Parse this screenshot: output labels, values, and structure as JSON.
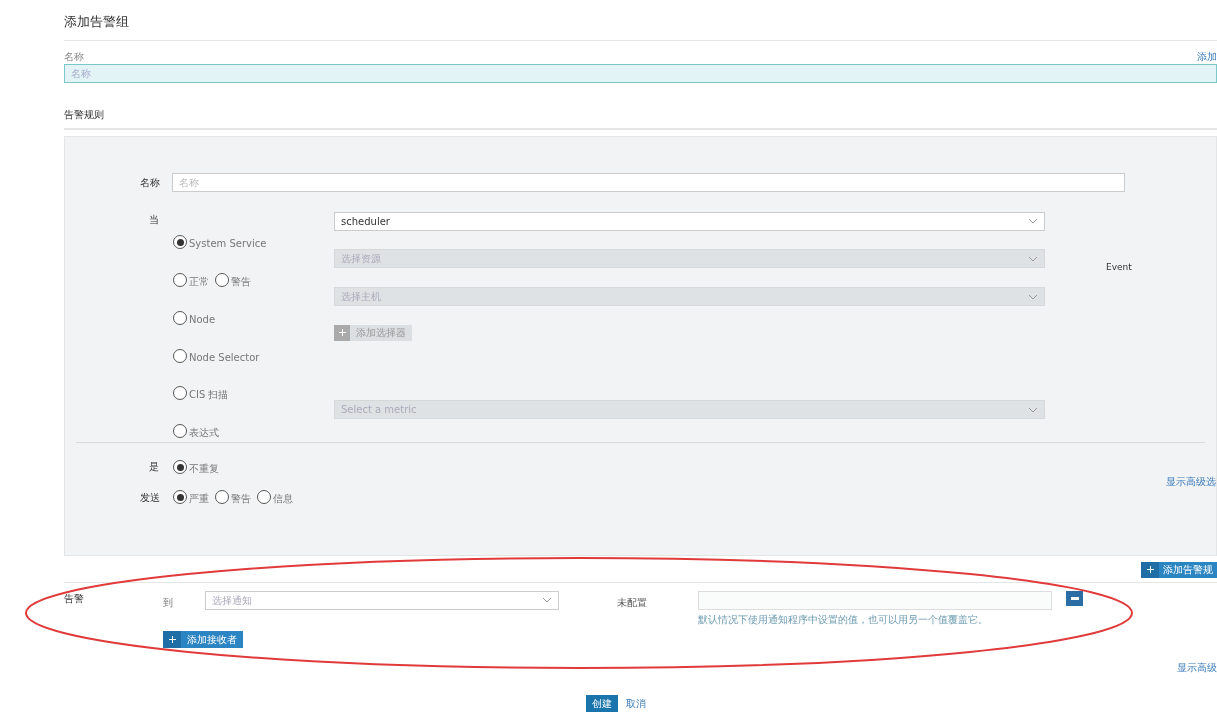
{
  "title": "添加告警组",
  "group_name": {
    "label": "名称",
    "placeholder": "名称",
    "side_link": "添加"
  },
  "rules_heading": "告警规则",
  "rule": {
    "name_label": "名称",
    "name_placeholder": "名称",
    "when_label": "当",
    "sources": [
      {
        "options": [
          {
            "label": "System Service",
            "selected": true
          }
        ],
        "select": {
          "value": "scheduler",
          "disabled": false
        }
      },
      {
        "options": [
          {
            "label": "正常",
            "selected": false
          },
          {
            "label": "警告",
            "selected": false
          }
        ],
        "select": {
          "placeholder": "选择资源",
          "disabled": true
        }
      },
      {
        "options": [
          {
            "label": "Node",
            "selected": false
          }
        ],
        "select": {
          "placeholder": "选择主机",
          "disabled": true
        }
      },
      {
        "options": [
          {
            "label": "Node Selector",
            "selected": false
          }
        ],
        "button": {
          "label": "添加选择器",
          "disabled": true
        }
      },
      {
        "options": [
          {
            "label": "CIS 扫描",
            "selected": false
          }
        ]
      },
      {
        "options": [
          {
            "label": "表达式",
            "selected": false
          }
        ],
        "select": {
          "placeholder": "Select a metric",
          "disabled": true
        }
      }
    ],
    "event_label": "Event",
    "is_label": "是",
    "is_options": [
      {
        "label": "不重复",
        "selected": true
      }
    ],
    "send_label": "发送",
    "send_options": [
      {
        "label": "严重",
        "selected": true
      },
      {
        "label": "警告",
        "selected": false
      },
      {
        "label": "信息",
        "selected": false
      }
    ],
    "advanced_link": "显示高级选"
  },
  "add_rule_button": "添加告警规",
  "alert": {
    "label": "告警",
    "to_label": "到",
    "notifier_placeholder": "选择通知",
    "unconfigured": "未配置",
    "hint": "默认情况下使用通知程序中设置的值，也可以用另一个值覆盖它。",
    "add_receiver": "添加接收者",
    "advanced_link": "显示高级"
  },
  "create_button": "创建",
  "cancel_button": "取消"
}
